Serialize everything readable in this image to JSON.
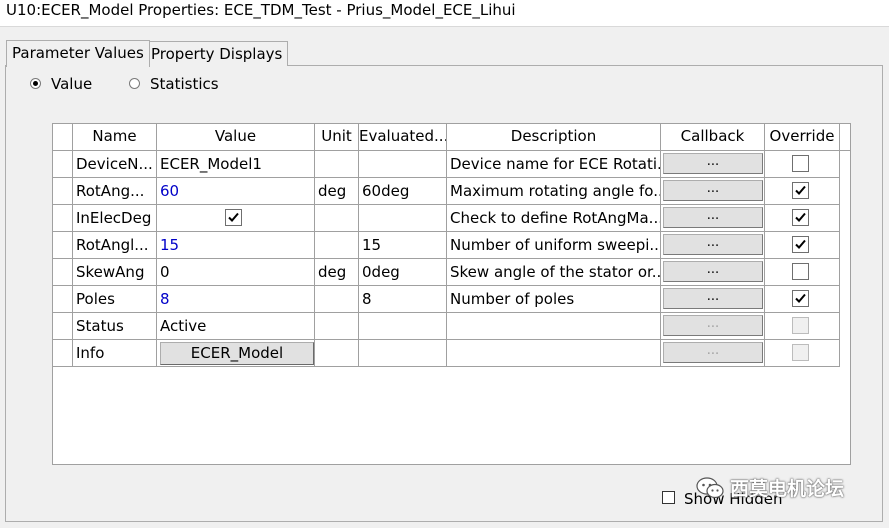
{
  "window": {
    "title": "U10:ECER_Model Properties: ECE_TDM_Test - Prius_Model_ECE_Lihui"
  },
  "tabs": [
    {
      "label": "Parameter Values",
      "active": true
    },
    {
      "label": "Property Displays",
      "active": false
    }
  ],
  "mode": {
    "options": [
      {
        "label": "Value",
        "selected": true
      },
      {
        "label": "Statistics",
        "selected": false
      }
    ]
  },
  "table": {
    "columns": [
      "Name",
      "Value",
      "Unit",
      "Evaluated...",
      "Description",
      "Callback",
      "Override"
    ],
    "rows": [
      {
        "name": "DeviceN...",
        "value": "ECER_Model1",
        "value_style": "plain",
        "unit": "",
        "evaluated": "",
        "description": "Device name for ECE Rotati...",
        "callback": "...",
        "callback_enabled": true,
        "override": false,
        "override_enabled": true
      },
      {
        "name": "RotAng...",
        "value": "60",
        "value_style": "blue",
        "unit": "deg",
        "evaluated": "60deg",
        "description": "Maximum rotating angle fo...",
        "callback": "...",
        "callback_enabled": true,
        "override": true,
        "override_enabled": true
      },
      {
        "name": "InElecDeg",
        "value": "",
        "value_style": "checkbox",
        "value_checked": true,
        "unit": "",
        "evaluated": "",
        "description": "Check to define RotAngMa...",
        "callback": "...",
        "callback_enabled": true,
        "override": true,
        "override_enabled": true
      },
      {
        "name": "RotAngl...",
        "value": "15",
        "value_style": "blue",
        "unit": "",
        "evaluated": "15",
        "description": "Number of uniform sweepi...",
        "callback": "...",
        "callback_enabled": true,
        "override": true,
        "override_enabled": true
      },
      {
        "name": "SkewAng",
        "value": "0",
        "value_style": "plain",
        "unit": "deg",
        "evaluated": "0deg",
        "description": "Skew angle of the stator or...",
        "callback": "...",
        "callback_enabled": true,
        "override": false,
        "override_enabled": true
      },
      {
        "name": "Poles",
        "value": "8",
        "value_style": "blue",
        "unit": "",
        "evaluated": "8",
        "description": "Number of poles",
        "callback": "...",
        "callback_enabled": true,
        "override": true,
        "override_enabled": true
      },
      {
        "name": "Status",
        "value": "Active",
        "value_style": "plain",
        "unit": "",
        "evaluated": "",
        "description": "",
        "callback": "...",
        "callback_enabled": false,
        "override": false,
        "override_enabled": false
      },
      {
        "name": "Info",
        "value": "ECER_Model",
        "value_style": "button",
        "unit": "",
        "evaluated": "",
        "description": "",
        "callback": "...",
        "callback_enabled": false,
        "override": false,
        "override_enabled": false
      }
    ]
  },
  "footer": {
    "show_hidden_label": "Show Hidden",
    "show_hidden_checked": false
  },
  "watermark": {
    "text": "西莫电机论坛"
  },
  "colors": {
    "value_blue": "#0000c8",
    "grid_line": "#a0a0a0",
    "background": "#f0f0f0"
  }
}
